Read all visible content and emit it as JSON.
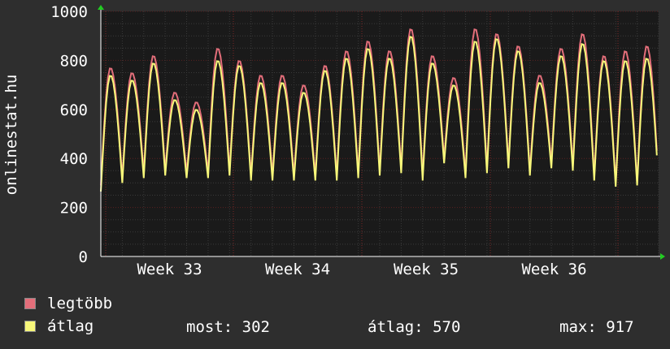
{
  "chart_data": {
    "type": "line",
    "ylabel": "onlinestat.hu",
    "ylim": [
      0,
      1000
    ],
    "yticks": [
      0,
      200,
      400,
      600,
      800,
      1000
    ],
    "xticks": [
      "Week 33",
      "Week 34",
      "Week 35",
      "Week 36"
    ],
    "grid": true,
    "colors": {
      "background": "#2e2e2e",
      "plot": "#1a1a1a",
      "legtobb": "#e36e7a",
      "atlag": "#f7f77a",
      "axis_arrow": "#22cc22"
    },
    "series": [
      {
        "name": "legtöbb",
        "daily_peaks": [
          770,
          750,
          820,
          670,
          630,
          850,
          800,
          740,
          740,
          700,
          780,
          840,
          880,
          840,
          930,
          820,
          730,
          930,
          910,
          860,
          740,
          850,
          910,
          820,
          840,
          860
        ],
        "daily_troughs": [
          290,
          320,
          340,
          350,
          340,
          340,
          350,
          330,
          330,
          330,
          330,
          330,
          340,
          350,
          360,
          330,
          400,
          340,
          360,
          380,
          350,
          380,
          370,
          330,
          300,
          300
        ]
      },
      {
        "name": "átlag",
        "daily_peaks": [
          740,
          720,
          790,
          640,
          600,
          800,
          780,
          710,
          710,
          670,
          760,
          810,
          850,
          810,
          900,
          790,
          700,
          880,
          890,
          840,
          710,
          820,
          870,
          800,
          800,
          810
        ],
        "daily_troughs": [
          265,
          300,
          320,
          330,
          320,
          320,
          330,
          310,
          310,
          310,
          310,
          310,
          320,
          330,
          340,
          310,
          380,
          320,
          340,
          360,
          330,
          360,
          350,
          310,
          285,
          290
        ]
      }
    ]
  },
  "legend": {
    "legtobb_label": "legtöbb",
    "atlag_label": "átlag",
    "most": "most: 302",
    "atlag_stat": "átlag: 570",
    "max": "max: 917"
  }
}
